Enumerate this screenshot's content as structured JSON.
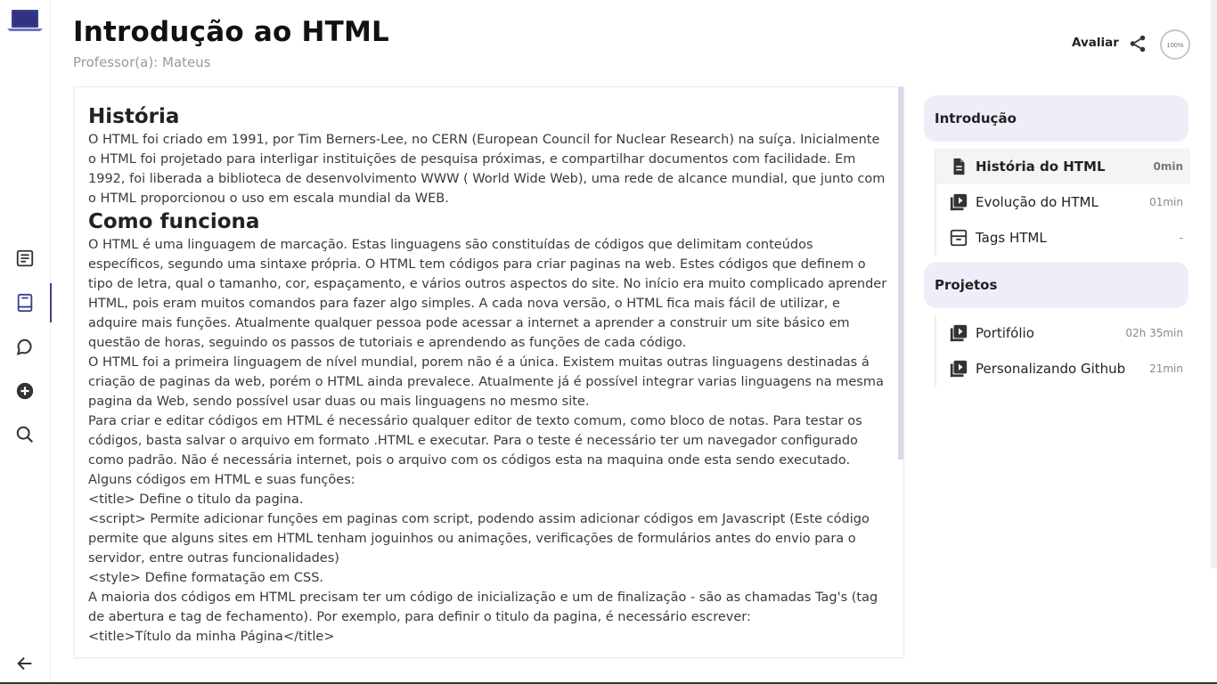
{
  "header": {
    "title": "Introdução ao HTML",
    "teacher": "Professor(a): Mateus",
    "rate_label": "Avaliar",
    "progress": "100%",
    "share_icon": "share-icon"
  },
  "rail": {
    "items": [
      "notes-icon",
      "book-icon",
      "chat-icon",
      "add-circle-icon",
      "search-icon",
      "arrow-back-icon"
    ],
    "active": "book-icon"
  },
  "article": {
    "h1": "História",
    "p1": "O HTML foi criado em 1991, por Tim Berners-Lee, no CERN (European Council for Nuclear Research) na suíça. Inicialmente o HTML foi projetado para interligar instituições de pesquisa próximas, e compartilhar documentos com facilidade. Em 1992, foi liberada a biblioteca de desenvolvimento WWW ( World Wide Web), uma rede de alcance mundial, que junto com o HTML proporcionou o uso em escala mundial da WEB.",
    "h2": "Como funciona",
    "p2": "O HTML é uma linguagem de marcação. Estas linguagens são constituídas de códigos que delimitam conteúdos específicos, segundo uma sintaxe própria. O HTML tem códigos para criar paginas na web. Estes códigos que definem o tipo de letra, qual o tamanho, cor, espaçamento, e vários outros aspectos do site. No início era muito complicado aprender HTML, pois eram muitos comandos para fazer algo simples. A cada nova versão, o HTML fica mais fácil de utilizar, e adquire mais funções. Atualmente qualquer pessoa pode acessar a internet a aprender a construir um site básico em questão de horas, seguindo os passos de tutoriais e aprendendo as funções de cada código.",
    "p3": "O HTML foi a primeira linguagem de nível mundial, porem não é a única. Existem muitas outras linguagens destinadas á criação de paginas da web, porém o HTML ainda prevalece. Atualmente já é possível integrar varias linguagens na mesma pagina da Web, sendo possível usar duas ou mais linguagens no mesmo site.",
    "p4": "Para criar e editar códigos em HTML é necessário qualquer editor de texto comum, como bloco de notas. Para testar os códigos, basta salvar o arquivo em formato .HTML e executar. Para o teste é necessário ter um navegador configurado como padrão. Não é necessária internet, pois o arquivo com os códigos esta na maquina onde esta sendo executado.",
    "p5": "Alguns códigos em HTML e suas funções:",
    "p6": "<title> Define o titulo da pagina.",
    "p7": "<script> Permite adicionar funções em paginas com script, podendo assim adicionar códigos em Javascript (Este código permite que alguns sites em HTML tenham joguinhos ou animações, verificações de formulários antes do envio para o servidor, entre outras funcionalidades)",
    "p8": "<style> Define formatação em CSS.",
    "p9": "A maioria dos códigos em HTML precisam ter um código de inicialização e um de finalização - são as chamadas Tag's (tag de abertura e tag de fechamento). Por exemplo, para definir o titulo da pagina, é necessário escrever:",
    "p10": "<title>Título da minha Página</title>"
  },
  "sidebar": {
    "sections": [
      {
        "title": "Introdução",
        "lessons": [
          {
            "name": "História do HTML",
            "duration": "0min",
            "icon": "document-icon",
            "active": true
          },
          {
            "name": "Evolução do HTML",
            "duration": "01min",
            "icon": "video-library-icon"
          },
          {
            "name": "Tags HTML",
            "duration": "-",
            "icon": "archive-icon"
          }
        ]
      },
      {
        "title": "Projetos",
        "lessons": [
          {
            "name": "Portifólio",
            "duration": "02h 35min",
            "icon": "video-library-icon"
          },
          {
            "name": "Personalizando Github",
            "duration": "21min",
            "icon": "video-library-icon"
          }
        ]
      }
    ]
  },
  "colors": {
    "accent": "#3a3f8f",
    "section_bg": "#eeeef9",
    "active_bg": "#f4f4f6",
    "muted_text": "#9a9a9a"
  }
}
